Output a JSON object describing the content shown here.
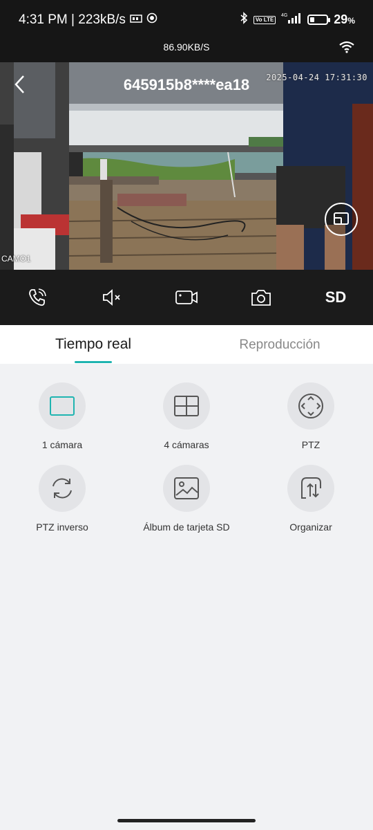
{
  "status_bar": {
    "time_speed": "4:31 PM | 223kB/s",
    "network": "4G",
    "volte": "Vo LTE",
    "battery_percent_text": "29",
    "battery_level": 0.29
  },
  "speed_bar": {
    "speed": "86.90KB/S"
  },
  "video": {
    "device_id": "645915b8****ea18",
    "timestamp": "2025-04-24 17:31:30",
    "channel": "CAMO1"
  },
  "controls": {
    "sd_label": "SD"
  },
  "tabs": [
    {
      "label": "Tiempo real",
      "active": true
    },
    {
      "label": "Reproducción",
      "active": false
    }
  ],
  "functions": [
    {
      "label": "1 cámara",
      "icon": "single-view-icon"
    },
    {
      "label": "4 cámaras",
      "icon": "quad-view-icon"
    },
    {
      "label": "PTZ",
      "icon": "ptz-icon"
    },
    {
      "label": "PTZ inverso",
      "icon": "rotate-icon"
    },
    {
      "label": "Álbum de tarjeta SD",
      "icon": "album-icon"
    },
    {
      "label": "Organizar",
      "icon": "sort-icon"
    }
  ],
  "colors": {
    "accent": "#1fb4b0",
    "dark_bar": "#1b1b1b"
  }
}
